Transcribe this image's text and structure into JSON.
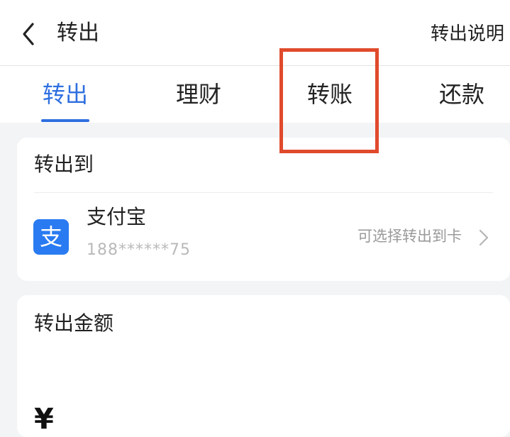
{
  "header": {
    "back_icon": "chevron-left-icon",
    "title": "转出",
    "right_link": "转出说明"
  },
  "tabs": [
    {
      "label": "转出",
      "active": true
    },
    {
      "label": "理财",
      "active": false
    },
    {
      "label": "转账",
      "active": false,
      "highlighted": true
    },
    {
      "label": "还款",
      "active": false
    }
  ],
  "transfer_to": {
    "section_label": "转出到",
    "account": {
      "icon": "alipay-icon",
      "icon_glyph": "支",
      "name": "支付宝",
      "number": "188******75",
      "select_hint": "可选择转出到卡"
    }
  },
  "amount": {
    "section_label": "转出金额",
    "currency_symbol": "¥"
  },
  "colors": {
    "accent": "#2f6fe0",
    "highlight": "#e04a2c",
    "alipay": "#2a7bf2"
  }
}
